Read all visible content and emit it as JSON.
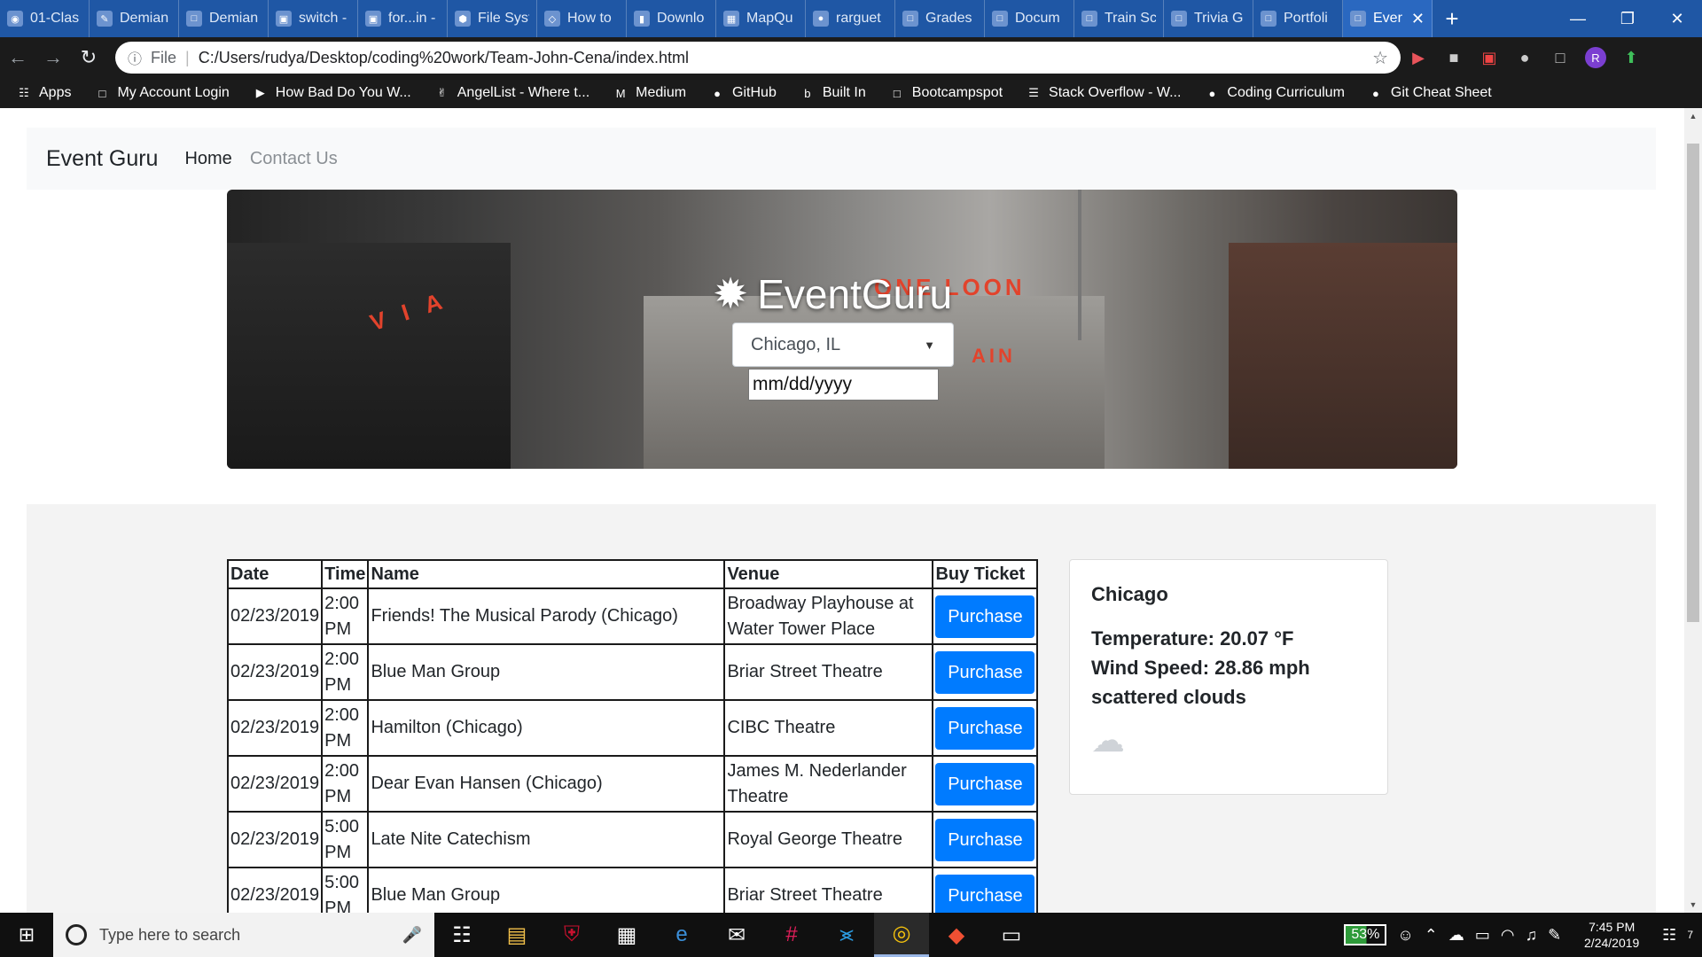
{
  "browser": {
    "tabs": [
      {
        "title": "01-Clas",
        "icon": "firefox-icon"
      },
      {
        "title": "Demian",
        "icon": "pen-icon"
      },
      {
        "title": "Demian",
        "icon": "doc-icon"
      },
      {
        "title": "switch -",
        "icon": "code-icon"
      },
      {
        "title": "for...in -",
        "icon": "code-icon"
      },
      {
        "title": "File Syst",
        "icon": "node-icon"
      },
      {
        "title": "How to",
        "icon": "diamond-icon"
      },
      {
        "title": "Downlo",
        "icon": "download-icon"
      },
      {
        "title": "MapQu",
        "icon": "map-icon"
      },
      {
        "title": "rarguet",
        "icon": "github-icon"
      },
      {
        "title": "Grades",
        "icon": "doc-icon"
      },
      {
        "title": "Docum",
        "icon": "doc-icon"
      },
      {
        "title": "Train Sc",
        "icon": "doc-icon"
      },
      {
        "title": "Trivia G",
        "icon": "doc-icon"
      },
      {
        "title": "Portfoli",
        "icon": "doc-icon"
      },
      {
        "title": "Ever",
        "icon": "doc-icon"
      }
    ],
    "address": {
      "scheme": "File",
      "url": "C:/Users/rudya/Desktop/coding%20work/Team-John-Cena/index.html"
    },
    "profile_initial": "R",
    "bookmarks": [
      {
        "label": "Apps",
        "icon": "apps-grid-icon"
      },
      {
        "label": "My Account Login",
        "icon": "doc-icon"
      },
      {
        "label": "How Bad Do You W...",
        "icon": "youtube-icon"
      },
      {
        "label": "AngelList - Where t...",
        "icon": "angellist-icon"
      },
      {
        "label": "Medium",
        "icon": "medium-icon"
      },
      {
        "label": "GitHub",
        "icon": "github-icon"
      },
      {
        "label": "Built In",
        "icon": "builtin-icon"
      },
      {
        "label": "Bootcampspot",
        "icon": "doc-icon"
      },
      {
        "label": "Stack Overflow - W...",
        "icon": "stackoverflow-icon"
      },
      {
        "label": "Coding Curriculum",
        "icon": "github-icon"
      },
      {
        "label": "Git Cheat Sheet",
        "icon": "github-icon"
      }
    ]
  },
  "site": {
    "brand": "Event Guru",
    "nav": {
      "home": "Home",
      "contact": "Contact Us"
    },
    "hero": {
      "logo_text": "EventGuru",
      "city_select": "Chicago, IL",
      "date_placeholder": "mm/dd/yyyy"
    },
    "table": {
      "headers": {
        "date": "Date",
        "time": "Time",
        "name": "Name",
        "venue": "Venue",
        "buy": "Buy Ticket"
      },
      "rows": [
        {
          "date": "02/23/2019",
          "time": "2:00 PM",
          "name": "Friends! The Musical Parody (Chicago)",
          "venue": "Broadway Playhouse at Water Tower Place",
          "buy": "Purchase"
        },
        {
          "date": "02/23/2019",
          "time": "2:00 PM",
          "name": "Blue Man Group",
          "venue": "Briar Street Theatre",
          "buy": "Purchase"
        },
        {
          "date": "02/23/2019",
          "time": "2:00 PM",
          "name": "Hamilton (Chicago)",
          "venue": "CIBC Theatre",
          "buy": "Purchase"
        },
        {
          "date": "02/23/2019",
          "time": "2:00 PM",
          "name": "Dear Evan Hansen (Chicago)",
          "venue": "James M. Nederlander Theatre",
          "buy": "Purchase"
        },
        {
          "date": "02/23/2019",
          "time": "5:00 PM",
          "name": "Late Nite Catechism",
          "venue": "Royal George Theatre",
          "buy": "Purchase"
        },
        {
          "date": "02/23/2019",
          "time": "5:00 PM",
          "name": "Blue Man Group",
          "venue": "Briar Street Theatre",
          "buy": "Purchase"
        }
      ]
    },
    "weather": {
      "city": "Chicago",
      "temperature": "Temperature: 20.07 °F",
      "wind": "Wind Speed: 28.86 mph",
      "description": "scattered clouds",
      "icon": "cloud-icon"
    }
  },
  "taskbar": {
    "search_placeholder": "Type here to search",
    "battery": "53%",
    "time": "7:45 PM",
    "date": "2/24/2019",
    "notifications": "7"
  },
  "colors": {
    "tab_strip": "#1f57a5",
    "primary_button": "#007bff",
    "navbar_bg": "#f8f9fa",
    "section_bg": "#f3f3f3"
  }
}
